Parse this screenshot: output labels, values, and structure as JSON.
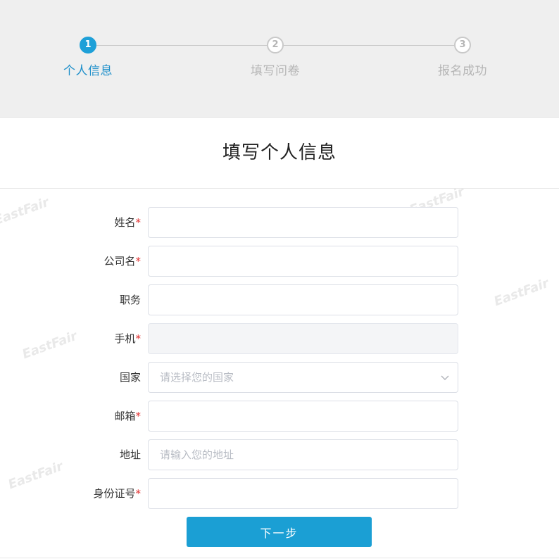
{
  "steps": [
    {
      "number": "1",
      "label": "个人信息",
      "state": "active"
    },
    {
      "number": "2",
      "label": "填写问卷",
      "state": "inactive"
    },
    {
      "number": "3",
      "label": "报名成功",
      "state": "inactive"
    }
  ],
  "page_title": "填写个人信息",
  "fields": {
    "name": {
      "label": "姓名",
      "required_mark": "*",
      "value": ""
    },
    "company": {
      "label": "公司名",
      "required_mark": "*",
      "value": ""
    },
    "position": {
      "label": "职务",
      "value": ""
    },
    "phone": {
      "label": "手机",
      "required_mark": "*",
      "value": "",
      "disabled": true
    },
    "country": {
      "label": "国家",
      "placeholder": "请选择您的国家"
    },
    "email": {
      "label": "邮箱",
      "required_mark": "*",
      "value": ""
    },
    "address": {
      "label": "地址",
      "placeholder": "请输入您的地址"
    },
    "id_number": {
      "label": "身份证号",
      "required_mark": "*",
      "value": ""
    }
  },
  "submit_label": "下一步",
  "watermark_text": "EastFair",
  "colors": {
    "accent": "#1ea0d8",
    "button": "#1b9fd4",
    "required": "#e03131",
    "inactive": "#b5b5b5",
    "header_bg": "#efefef"
  }
}
